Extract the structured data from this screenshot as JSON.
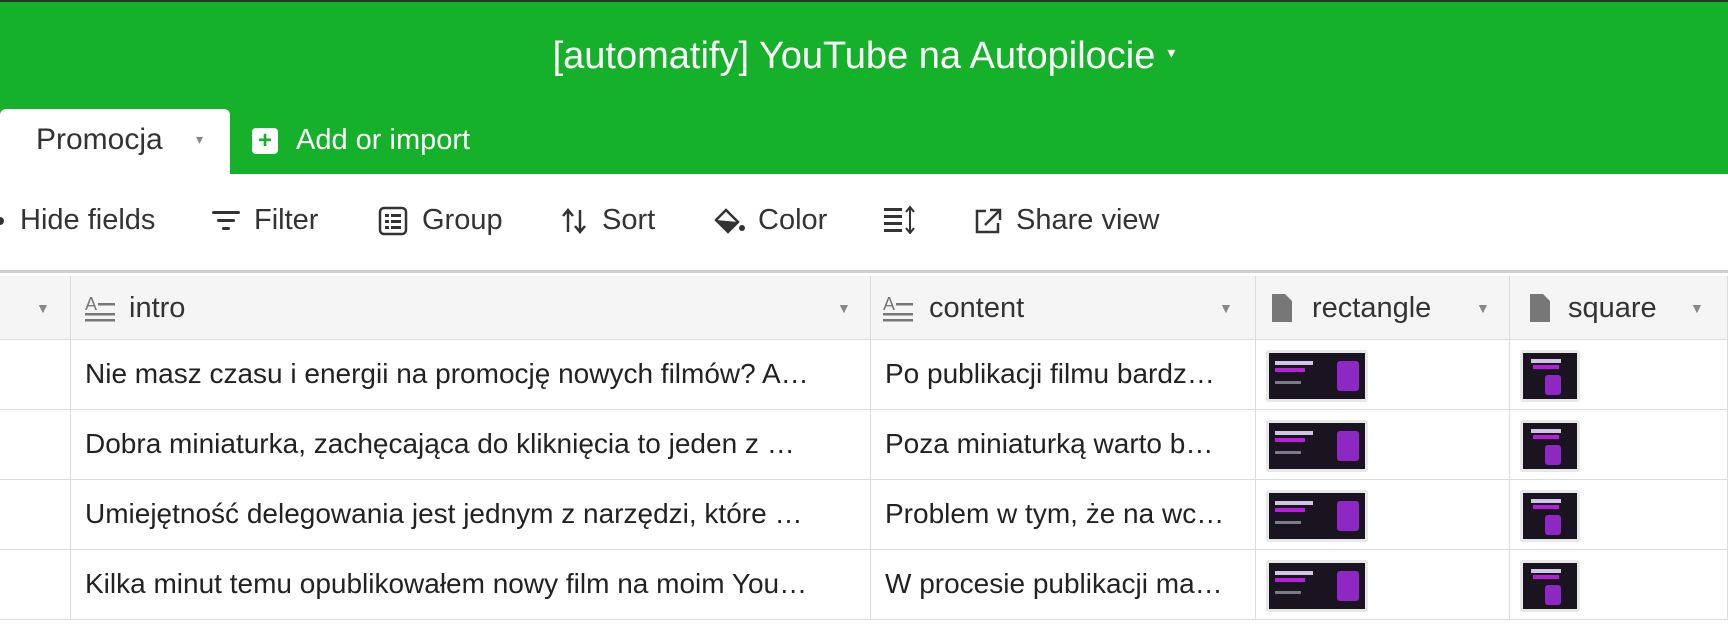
{
  "app": {
    "base_title": "[automatify] YouTube na Autopilocie",
    "title_caret": "▾"
  },
  "tabs": {
    "active": {
      "label": "Promocja",
      "caret": "▾"
    },
    "add": {
      "label": "Add or import"
    }
  },
  "toolbar": {
    "hide_fields": "Hide fields",
    "filter": "Filter",
    "group": "Group",
    "sort": "Sort",
    "color": "Color",
    "share_view": "Share view"
  },
  "grid": {
    "columns": [
      {
        "name": "",
        "icon": ""
      },
      {
        "name": "intro",
        "icon": "long-text-icon"
      },
      {
        "name": "content",
        "icon": "long-text-icon"
      },
      {
        "name": "rectangle",
        "icon": "attachment-icon"
      },
      {
        "name": "square",
        "icon": "attachment-icon"
      }
    ],
    "rows": [
      {
        "intro": "Nie masz czasu i energii na promocję nowych filmów? A…",
        "content": "Po publikacji filmu bardz…"
      },
      {
        "intro": "Dobra miniaturka, zachęcająca do kliknięcia to jeden z …",
        "content": "Poza miniaturką warto b…"
      },
      {
        "intro": "Umiejętność delegowania jest jednym z narzędzi, które …",
        "content": "Problem w tym, że na wc…"
      },
      {
        "intro": "Kilka minut temu opublikowałem nowy film na moim You…",
        "content": "W procesie publikacji ma…"
      }
    ]
  },
  "colors": {
    "header_bg": "#16b12a",
    "thumbnail_bg": "#1a1320",
    "thumbnail_accent": "#b61fd9"
  }
}
